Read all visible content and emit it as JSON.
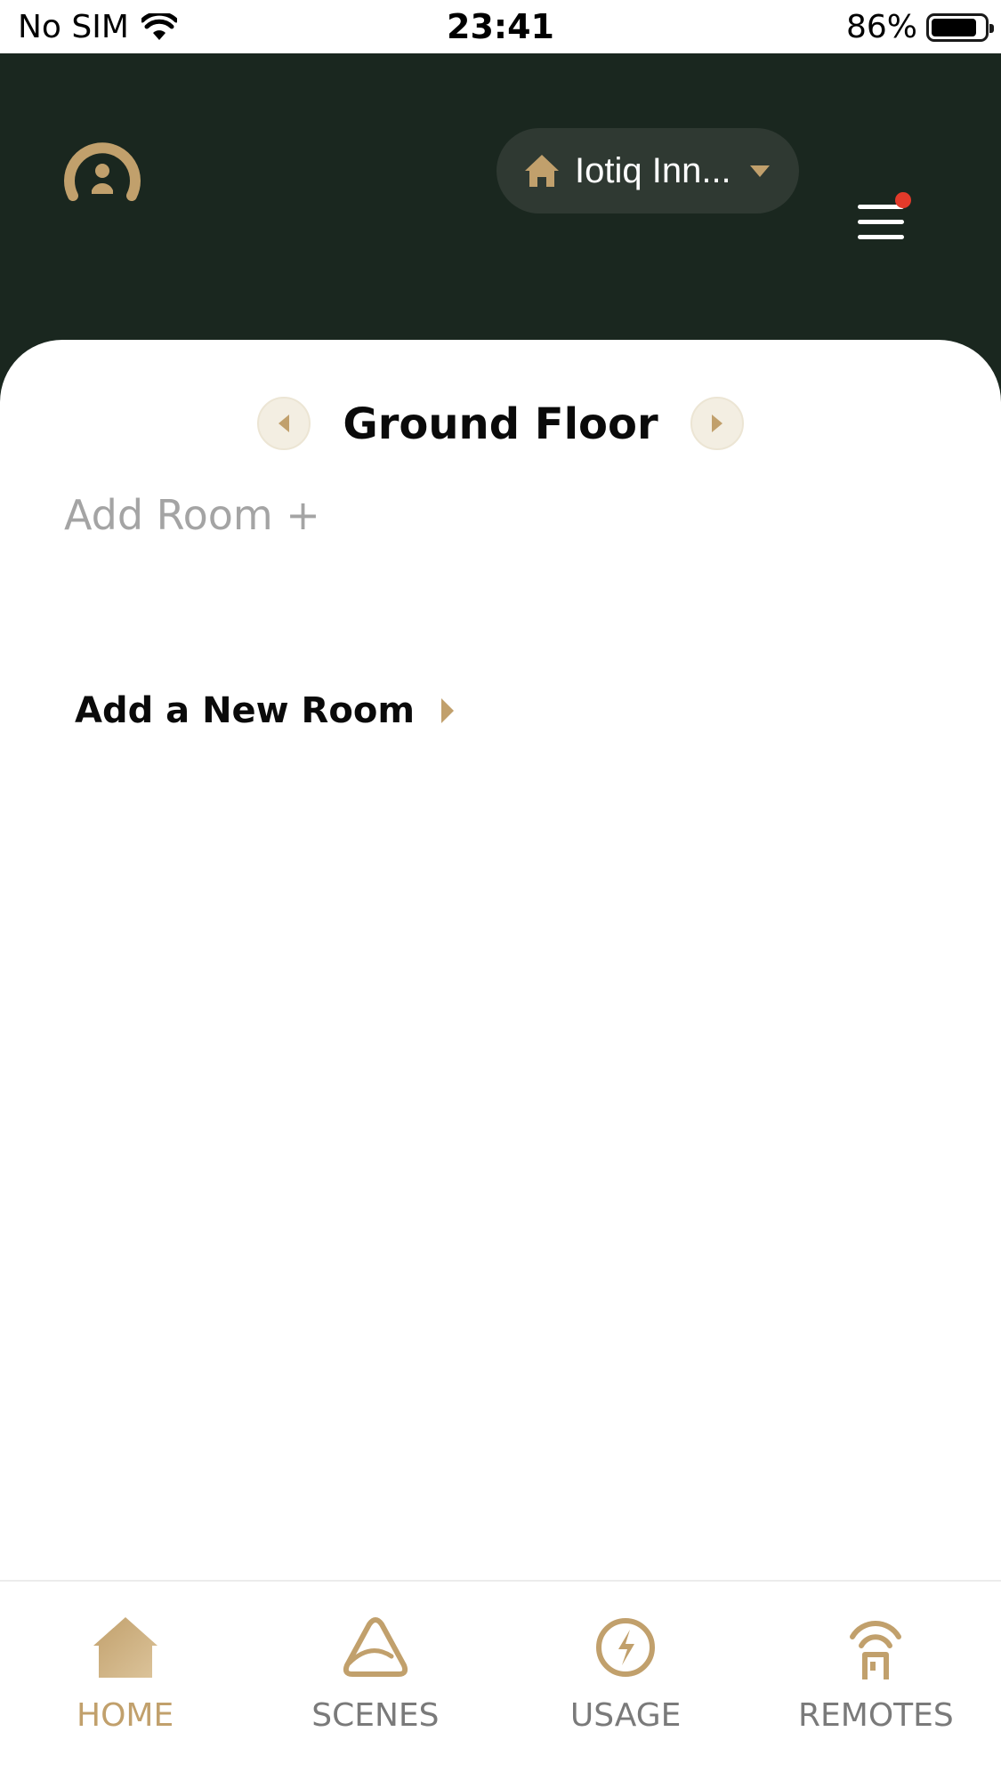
{
  "status_bar": {
    "carrier": "No SIM",
    "time": "23:41",
    "battery": "86%",
    "battery_level": 0.86
  },
  "header": {
    "home_selector_label": "Iotiq Inn...",
    "has_notification": true
  },
  "floor": {
    "title": "Ground Floor"
  },
  "add_room_link": "Add Room +",
  "add_new_room_label": "Add a New Room",
  "tabs": [
    {
      "label": "HOME",
      "icon": "home-icon",
      "active": true
    },
    {
      "label": "SCENES",
      "icon": "scenes-icon",
      "active": false
    },
    {
      "label": "USAGE",
      "icon": "usage-icon",
      "active": false
    },
    {
      "label": "REMOTES",
      "icon": "remote-icon",
      "active": false
    }
  ],
  "colors": {
    "header_bg": "#1a271f",
    "selector_bg": "#2f3932",
    "accent_gold": "#c1a06c",
    "notification_red": "#e23a2a",
    "inactive_tab": "#7a7a7a",
    "placeholder_text": "#a4a4a4"
  }
}
